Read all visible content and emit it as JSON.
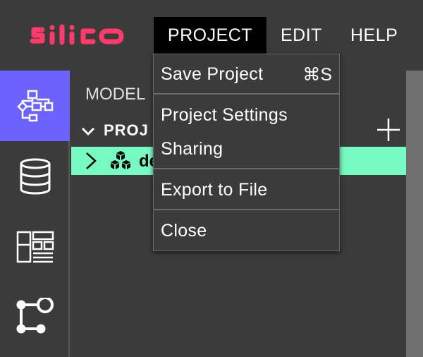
{
  "app": {
    "logo_text": "silico"
  },
  "menubar": {
    "project": "PROJECT",
    "edit": "EDIT",
    "help": "HELP"
  },
  "sidebar": {
    "items": [
      {
        "icon": "flowchart-icon",
        "active": true
      },
      {
        "icon": "database-icon",
        "active": false
      },
      {
        "icon": "dashboard-layout-icon",
        "active": false
      },
      {
        "icon": "connection-graph-icon",
        "active": false
      }
    ]
  },
  "panel": {
    "header": "MODEL",
    "project_label": "PROJ",
    "tree_item_label": "de"
  },
  "dropdown": {
    "save": "Save Project",
    "save_shortcut": "⌘S",
    "settings": "Project Settings",
    "sharing": "Sharing",
    "export": "Export to File",
    "close": "Close"
  },
  "colors": {
    "accent": "#6c63ff",
    "logo": "#ff3b6b",
    "tree_highlight": "#77f9c2"
  }
}
